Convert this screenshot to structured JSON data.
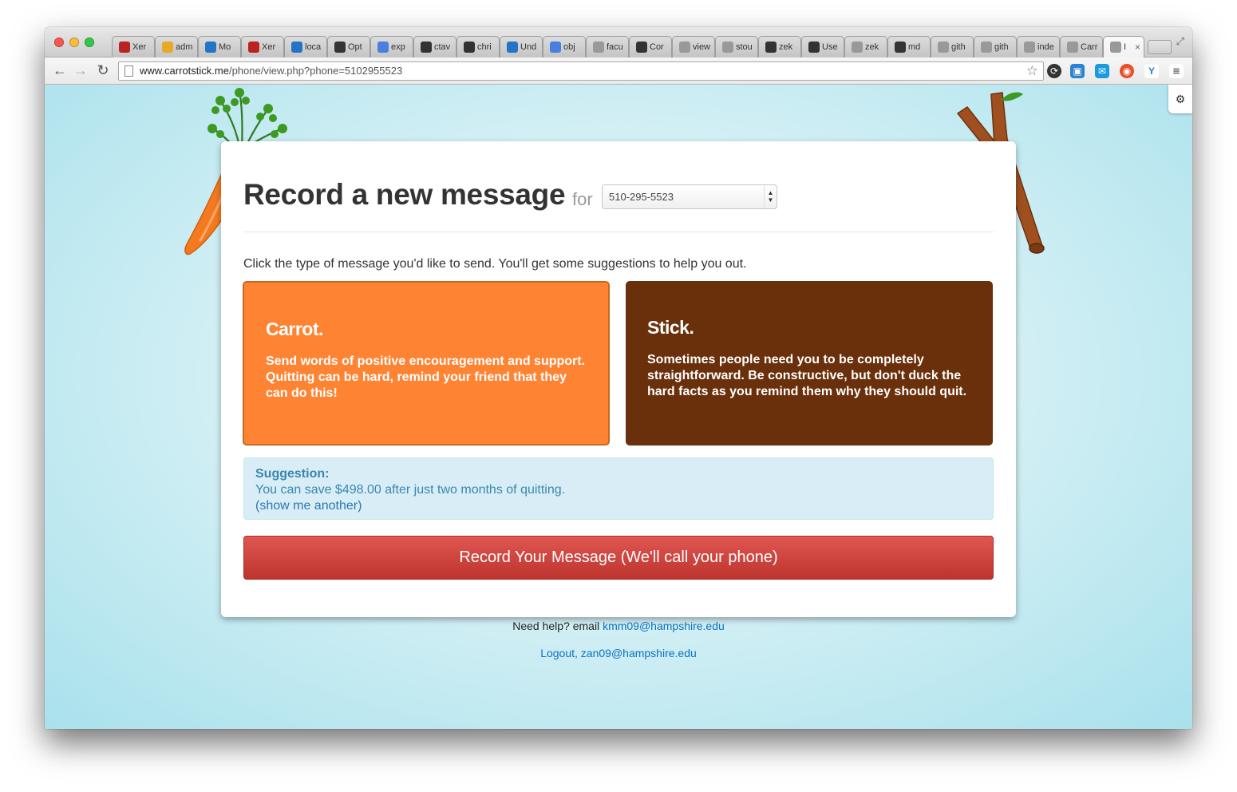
{
  "browser": {
    "tabs": [
      {
        "label": "Xer",
        "fav_color": "#b22"
      },
      {
        "label": "adm",
        "fav_color": "#e9a826"
      },
      {
        "label": "Mo",
        "fav_color": "#2474c5"
      },
      {
        "label": "Xer",
        "fav_color": "#b22"
      },
      {
        "label": "loca",
        "fav_color": "#2474c5"
      },
      {
        "label": "Opt",
        "fav_color": "#333"
      },
      {
        "label": "exp",
        "fav_color": "#4a7fe0"
      },
      {
        "label": "ctav",
        "fav_color": "#333"
      },
      {
        "label": "chri",
        "fav_color": "#333"
      },
      {
        "label": "Und",
        "fav_color": "#2474c5"
      },
      {
        "label": "obj",
        "fav_color": "#4a7fe0"
      },
      {
        "label": "facu",
        "fav_color": "#999"
      },
      {
        "label": "Cor",
        "fav_color": "#333"
      },
      {
        "label": "view",
        "fav_color": "#999"
      },
      {
        "label": "stou",
        "fav_color": "#999"
      },
      {
        "label": "zek",
        "fav_color": "#333"
      },
      {
        "label": "Use",
        "fav_color": "#333"
      },
      {
        "label": "zek",
        "fav_color": "#999"
      },
      {
        "label": "md",
        "fav_color": "#333"
      },
      {
        "label": "gith",
        "fav_color": "#999"
      },
      {
        "label": "gith",
        "fav_color": "#999"
      },
      {
        "label": "inde",
        "fav_color": "#999"
      },
      {
        "label": "Carr",
        "fav_color": "#999"
      },
      {
        "label": "I",
        "fav_color": "#999",
        "active": true
      }
    ],
    "url_domain": "www.carrotstick.me",
    "url_path": "/phone/view.php?phone=5102955523"
  },
  "page": {
    "heading": "Record a new message",
    "for_label": "for",
    "phone_selected": "510-295-5523",
    "intro": "Click the type of message you'd like to send. You'll get some suggestions to help you out.",
    "carrot": {
      "title": "Carrot.",
      "description": "Send words of positive encouragement and support. Quitting can be hard, remind your friend that they can do this!"
    },
    "stick": {
      "title": "Stick.",
      "description": "Sometimes people need you to be completely straightforward. Be constructive, but don't duck the hard facts as you remind them why they should quit."
    },
    "suggestion": {
      "title": "Suggestion:",
      "text": "You can save $498.00 after just two months of quitting.",
      "link": "(show me another)"
    },
    "record_button": "Record Your Message (We'll call your phone)",
    "footer_help_prefix": "Need help? email",
    "footer_help_email": "kmm09@hampshire.edu",
    "footer_logout": "Logout, zan09@hampshire.edu"
  },
  "colors": {
    "carrot": "#fe8434",
    "stick": "#6a2f0b",
    "record": "#c93a35",
    "link": "#0a73c0"
  }
}
